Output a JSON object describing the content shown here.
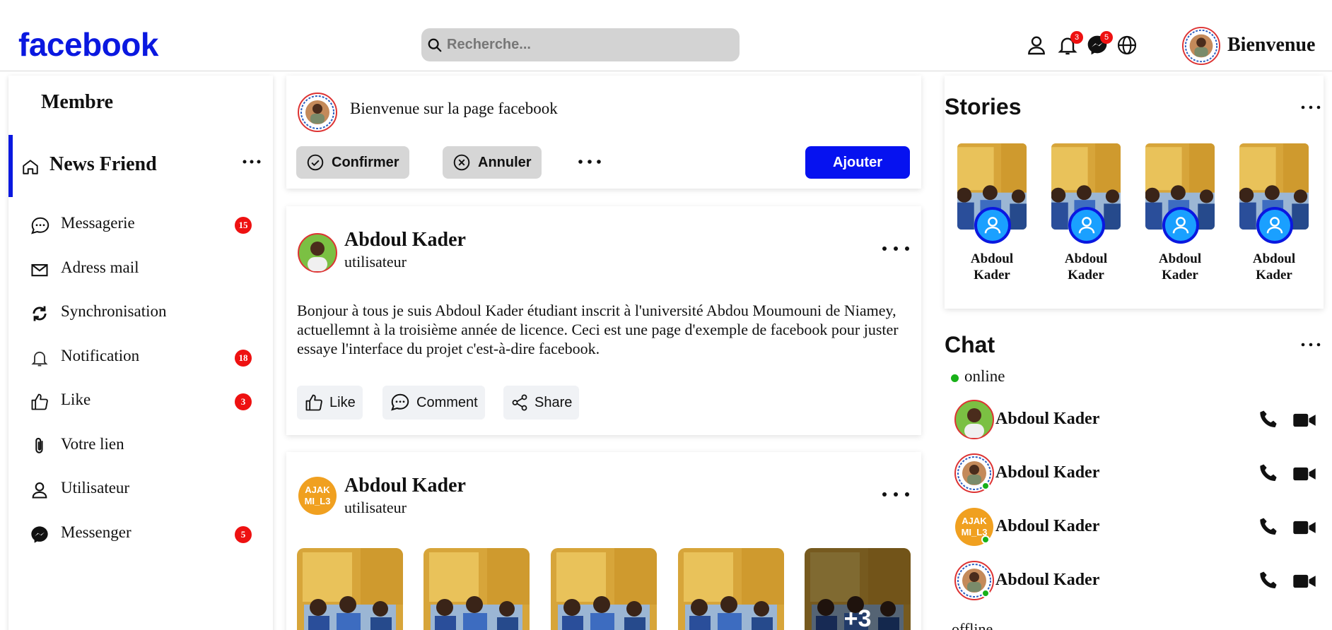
{
  "header": {
    "logo": "facebook",
    "search_placeholder": "Recherche...",
    "notifications_count": "3",
    "messages_count": "5",
    "greeting": "Bienvenue"
  },
  "sidebar": {
    "title": "Membre",
    "active_item": "News Friend",
    "items": [
      {
        "label": "Messagerie",
        "badge": "15",
        "icon": "chat-bubble-icon"
      },
      {
        "label": "Adress mail",
        "badge": "",
        "icon": "mail-icon"
      },
      {
        "label": "Synchronisation",
        "badge": "",
        "icon": "sync-icon"
      },
      {
        "label": "Notification",
        "badge": "18",
        "icon": "bell-icon"
      },
      {
        "label": "Like",
        "badge": "3",
        "icon": "thumbs-up-icon"
      },
      {
        "label": "Votre lien",
        "badge": "",
        "icon": "paperclip-icon"
      },
      {
        "label": "Utilisateur",
        "badge": "",
        "icon": "user-icon"
      },
      {
        "label": "Messenger",
        "badge": "5",
        "icon": "messenger-icon"
      }
    ]
  },
  "welcome_card": {
    "text": "Bienvenue sur la page facebook",
    "confirm": "Confirmer",
    "cancel": "Annuler",
    "add": "Ajouter"
  },
  "post1": {
    "author": "Abdoul Kader",
    "role": "utilisateur",
    "text": "Bonjour à tous je suis Abdoul Kader étudiant inscrit à l'université Abdou Moumouni de Niamey, actuellemnt à la troisième année de licence. Ceci est une page d'exemple de facebook pour juster essaye l'interface du projet c'est-à-dire facebook.",
    "like": "Like",
    "comment": "Comment",
    "share": "Share"
  },
  "post2": {
    "author": "Abdoul Kader",
    "role": "utilisateur",
    "avatar_text_1": "AJAK",
    "avatar_text_2": "MI_L3",
    "more_photos": "+3"
  },
  "stories": {
    "title": "Stories",
    "items": [
      {
        "name": "Abdoul Kader"
      },
      {
        "name": "Abdoul Kader"
      },
      {
        "name": "Abdoul Kader"
      },
      {
        "name": "Abdoul Kader"
      }
    ]
  },
  "chat": {
    "title": "Chat",
    "online_label": "online",
    "contacts": [
      {
        "name": "Abdoul Kader"
      },
      {
        "name": "Abdoul Kader"
      },
      {
        "name": "Abdoul Kader",
        "avatar_text_1": "AJAK",
        "avatar_text_2": "MI_L3"
      },
      {
        "name": "Abdoul Kader"
      }
    ],
    "offline_label": "offline"
  },
  "colors": {
    "brand": "#0a18e0",
    "badge": "#ee1111",
    "online": "#18b018"
  }
}
